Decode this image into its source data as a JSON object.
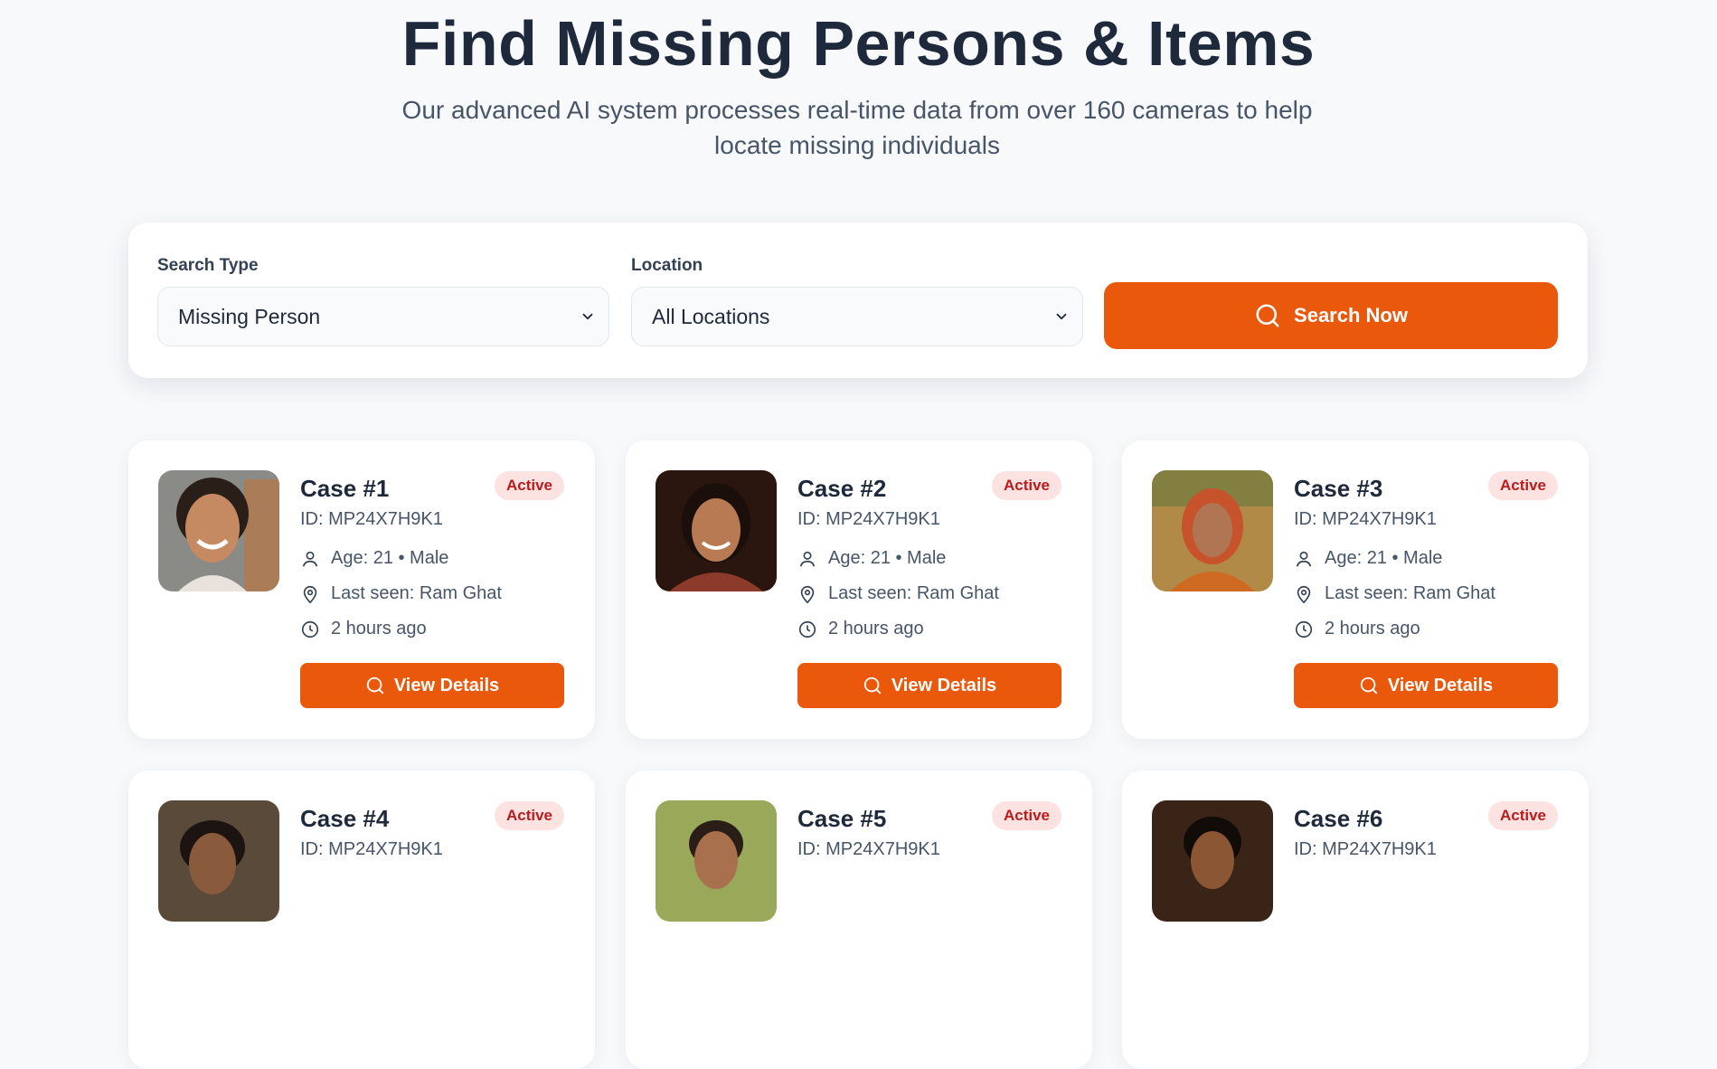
{
  "hero": {
    "title": "Find Missing Persons & Items",
    "subtitle": "Our advanced AI system processes real-time data from over 160 cameras to help locate missing individuals"
  },
  "search": {
    "type_label": "Search Type",
    "type_value": "Missing Person",
    "location_label": "Location",
    "location_value": "All Locations",
    "button_label": "Search Now"
  },
  "cases": [
    {
      "title": "Case #1",
      "id": "ID: MP24X7H9K1",
      "status": "Active",
      "age": "Age: 21 • Male",
      "last_seen": "Last seen: Ram Ghat",
      "time": "2 hours ago",
      "button": "View Details"
    },
    {
      "title": "Case #2",
      "id": "ID: MP24X7H9K1",
      "status": "Active",
      "age": "Age: 21 • Male",
      "last_seen": "Last seen: Ram Ghat",
      "time": "2 hours ago",
      "button": "View Details"
    },
    {
      "title": "Case #3",
      "id": "ID: MP24X7H9K1",
      "status": "Active",
      "age": "Age: 21 • Male",
      "last_seen": "Last seen: Ram Ghat",
      "time": "2 hours ago",
      "button": "View Details"
    },
    {
      "title": "Case #4",
      "id": "ID: MP24X7H9K1",
      "status": "Active"
    },
    {
      "title": "Case #5",
      "id": "ID: MP24X7H9K1",
      "status": "Active"
    },
    {
      "title": "Case #6",
      "id": "ID: MP24X7H9K1",
      "status": "Active"
    }
  ],
  "colors": {
    "accent": "#ea580c",
    "badge_bg": "#fde2e2",
    "badge_text": "#b91c1c"
  }
}
